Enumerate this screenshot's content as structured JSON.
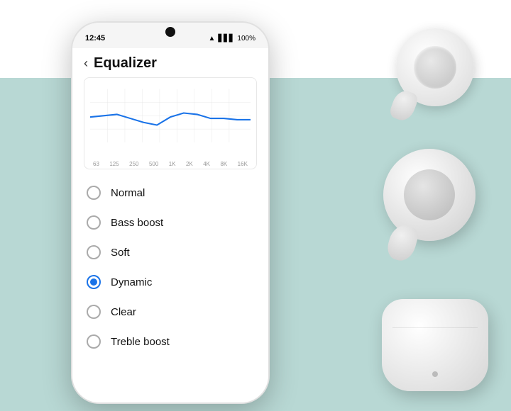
{
  "status": {
    "time": "12:45",
    "battery": "100%",
    "signal": "WiFi"
  },
  "header": {
    "back_label": "‹",
    "title": "Equalizer"
  },
  "chart": {
    "x_labels": [
      "63",
      "125",
      "250",
      "500",
      "1K",
      "2K",
      "4K",
      "8K",
      "16K"
    ]
  },
  "options": [
    {
      "label": "Normal",
      "selected": false
    },
    {
      "label": "Bass boost",
      "selected": false
    },
    {
      "label": "Soft",
      "selected": false
    },
    {
      "label": "Dynamic",
      "selected": true
    },
    {
      "label": "Clear",
      "selected": false
    },
    {
      "label": "Treble boost",
      "selected": false
    }
  ]
}
